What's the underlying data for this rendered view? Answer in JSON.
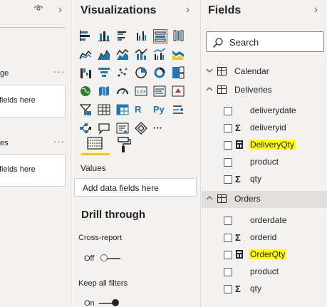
{
  "filters": {
    "labels": [
      "ge",
      "es"
    ],
    "box_text": [
      "fields here",
      "fields here"
    ]
  },
  "viz": {
    "title": "Visualizations",
    "values_label": "Values",
    "add_fields_placeholder": "Add data fields here",
    "drill_title": "Drill through",
    "cross_report_label": "Cross-report",
    "cross_report_value": "Off",
    "keep_filters_label": "Keep all filters",
    "keep_filters_value": "On",
    "icons": [
      "stacked-bar-icon",
      "stacked-column-icon",
      "clustered-bar-icon",
      "clustered-column-icon",
      "100-bar-icon",
      "100-column-icon",
      "line-chart-icon",
      "area-chart-icon",
      "stacked-area-icon",
      "line-column-icon",
      "line-clustered-column-icon",
      "ribbon-chart-icon",
      "waterfall-icon",
      "funnel-icon",
      "scatter-icon",
      "pie-icon",
      "donut-icon",
      "treemap-icon",
      "map-icon",
      "filled-map-icon",
      "gauge-icon",
      "card-icon",
      "multirow-card-icon",
      "kpi-icon",
      "slicer-icon",
      "table-icon",
      "matrix-icon",
      "r-visual-icon",
      "python-visual-icon",
      "key-influencers-icon",
      "decomposition-tree-icon",
      "qa-icon",
      "smart-narrative-icon",
      "power-apps-icon",
      "more-visuals-icon"
    ],
    "icon_text": {
      "card": "123",
      "r": "R",
      "py": "Py",
      "more": "···"
    }
  },
  "fields": {
    "title": "Fields",
    "search_placeholder": "Search",
    "tables": [
      {
        "name": "Calendar",
        "expanded": false,
        "fields": []
      },
      {
        "name": "Deliveries",
        "expanded": true,
        "fields": [
          {
            "name": "deliverydate",
            "kind": "plain",
            "highlighted": false
          },
          {
            "name": "deliveryid",
            "kind": "sum",
            "highlighted": false
          },
          {
            "name": "DeliveryQty",
            "kind": "measure",
            "highlighted": true
          },
          {
            "name": "product",
            "kind": "plain",
            "highlighted": false
          },
          {
            "name": "qty",
            "kind": "sum",
            "highlighted": false
          }
        ]
      },
      {
        "name": "Orders",
        "expanded": true,
        "fields": [
          {
            "name": "orderdate",
            "kind": "plain",
            "highlighted": false
          },
          {
            "name": "orderid",
            "kind": "sum",
            "highlighted": false
          },
          {
            "name": "OrderQty",
            "kind": "measure",
            "highlighted": true
          },
          {
            "name": "product",
            "kind": "plain",
            "highlighted": false
          },
          {
            "name": "qty",
            "kind": "sum",
            "highlighted": false
          }
        ]
      }
    ]
  },
  "colors": {
    "highlight": "#ffff00",
    "accent_tab": "#f2c811",
    "icon_blue": "#1f77b4",
    "pane_bg": "#f3f2f1"
  }
}
